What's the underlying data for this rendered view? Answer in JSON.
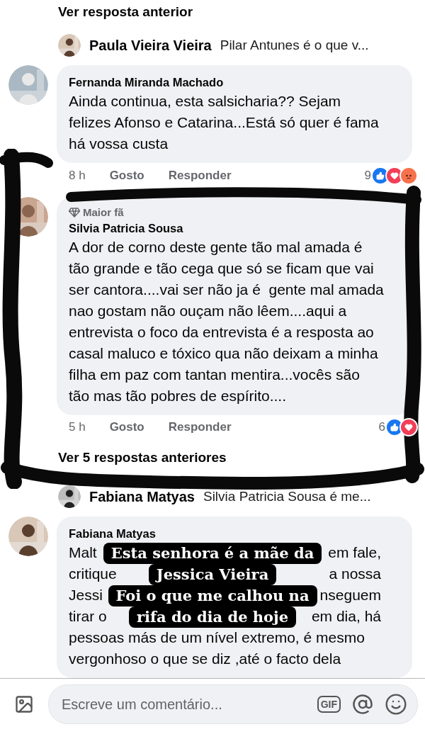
{
  "feed": [
    {
      "kind": "more_link",
      "label": "Ver resposta anterior"
    },
    {
      "kind": "reply_preview",
      "author": "Paula Vieira Vieira",
      "text": "Pilar Antunes é o que v..."
    },
    {
      "kind": "comment",
      "author": "Fernanda Miranda Machado",
      "text": "Ainda continua, esta salsicharia?? Sejam felizes Afonso e Catarina...Está só quer é fama há vossa custa",
      "time": "8 h",
      "like": "Gosto",
      "reply": "Responder",
      "reaction_count": "9",
      "reactions": [
        {
          "kind": "like"
        },
        {
          "kind": "love"
        },
        {
          "kind": "angry"
        }
      ]
    },
    {
      "kind": "comment",
      "badge": "Maior fã",
      "author": "Silvia Patricia Sousa",
      "text": "A dor de corno deste gente tão mal amada é tão grande e tão cega que só se ficam que vai ser cantora....vai ser não ja é  gente mal amada nao gostam não ouçam não lêem....aqui a entrevista o foco da entrevista é a resposta ao casal maluco e tóxico qua não deixam a minha filha em paz com tantan mentira...vocês são tão mas tão pobres de espírito....",
      "time": "5 h",
      "like": "Gosto",
      "reply": "Responder",
      "reaction_count": "6",
      "reactions": [
        {
          "kind": "like"
        },
        {
          "kind": "love"
        }
      ]
    },
    {
      "kind": "more_link",
      "label": "Ver 5 respostas anteriores"
    },
    {
      "kind": "reply_preview",
      "author": "Fabiana Matyas",
      "text": "Silvia Patricia Sousa é me..."
    },
    {
      "kind": "comment",
      "author": "Fabiana Matyas",
      "lines": [
        {
          "parts": [
            "Malt",
            "em fale,"
          ]
        },
        {
          "parts": [
            "critique",
            "a nossa"
          ]
        },
        {
          "parts": [
            "Jessi",
            "nseguem"
          ]
        },
        {
          "parts": [
            "tirar o",
            "em dia, há"
          ]
        },
        {
          "parts": [
            "pessoas más de um nível extremo, é mesmo"
          ]
        },
        {
          "parts": [
            "vergonhoso o que se diz ,até o facto dela"
          ]
        }
      ]
    }
  ],
  "caption": [
    "Esta senhora é a mãe da",
    "Jessica Vieira",
    "Foi o que me calhou na",
    "rifa do dia de hoje"
  ],
  "composer": {
    "placeholder": "Escreve um comentário...",
    "gif": "GIF"
  }
}
